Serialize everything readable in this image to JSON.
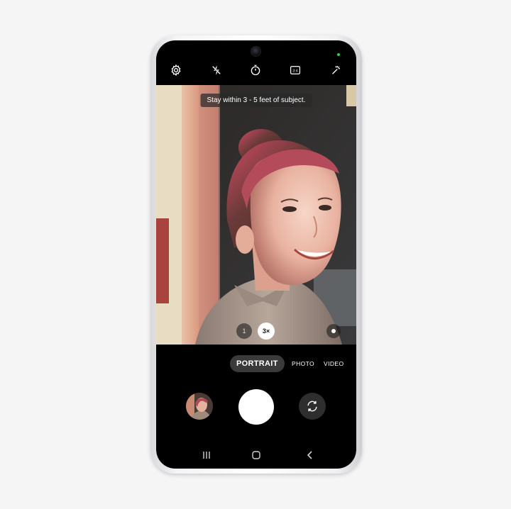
{
  "viewfinder": {
    "hint": "Stay within 3 - 5 feet of subject.",
    "zoom_options": [
      "1",
      "3×"
    ],
    "selected_zoom": "3×"
  },
  "toolbar": {
    "icons": [
      "settings-icon",
      "flash-off-icon",
      "timer-icon",
      "aspect-ratio-icon",
      "filters-icon"
    ],
    "aspect_label": "3:4"
  },
  "modes": {
    "items": [
      "PORTRAIT",
      "PHOTO",
      "VIDEO"
    ],
    "active": "PORTRAIT"
  },
  "capture": {
    "gallery": "gallery-thumbnail",
    "shutter": "shutter-button",
    "switch_camera": "switch-camera-icon"
  },
  "navbar": {
    "icons": [
      "recent-apps-icon",
      "home-icon",
      "back-icon"
    ]
  },
  "colors": {
    "accent": "#ffffff",
    "mode_pill": "#3a3a3a",
    "status_dot": "#2fd14b"
  }
}
